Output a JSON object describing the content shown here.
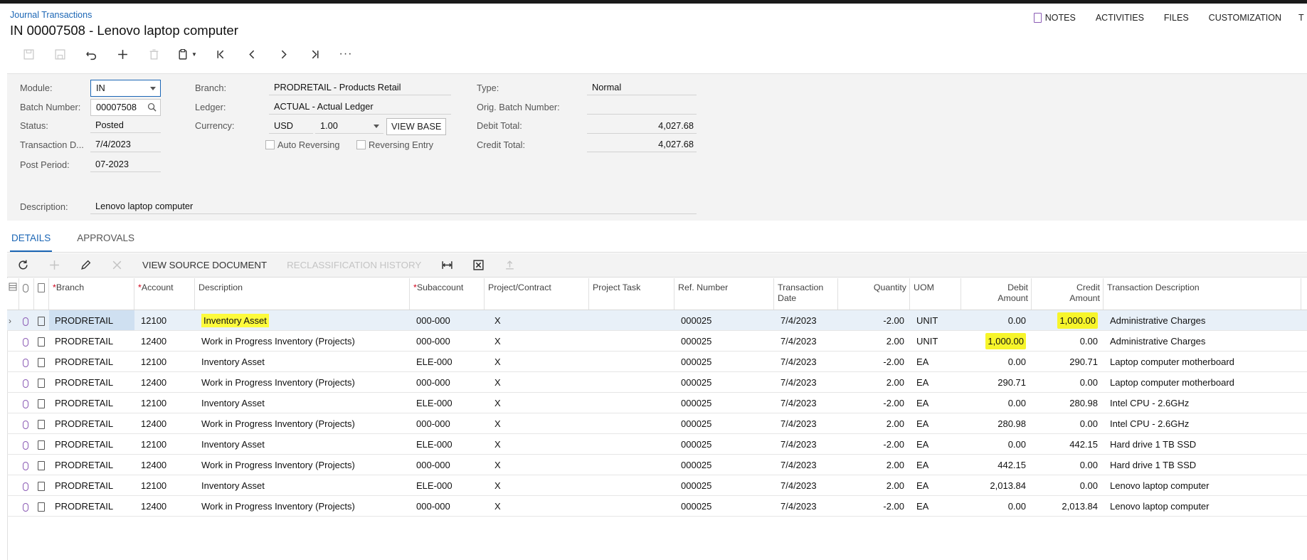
{
  "breadcrumb": "Journal Transactions",
  "title": "IN 00007508 - Lenovo laptop computer",
  "top_links": [
    "NOTES",
    "ACTIVITIES",
    "FILES",
    "CUSTOMIZATION",
    "T"
  ],
  "toolbar_icons": [
    "save-close-icon",
    "save-icon",
    "undo-icon",
    "add-icon",
    "delete-icon",
    "copy-paste-icon",
    "first-icon",
    "prev-icon",
    "next-icon",
    "last-icon",
    "more-icon"
  ],
  "form": {
    "module_label": "Module:",
    "module_value": "IN",
    "batch_label": "Batch Number:",
    "batch_value": "00007508",
    "status_label": "Status:",
    "status_value": "Posted",
    "trans_date_label": "Transaction D...",
    "trans_date_value": "7/4/2023",
    "post_period_label": "Post Period:",
    "post_period_value": "07-2023",
    "branch_label": "Branch:",
    "branch_value": "PRODRETAIL - Products Retail",
    "ledger_label": "Ledger:",
    "ledger_value": "ACTUAL - Actual Ledger",
    "currency_label": "Currency:",
    "currency_value": "USD",
    "rate_value": "1.00",
    "view_base": "VIEW BASE",
    "auto_reversing": "Auto Reversing",
    "reversing_entry": "Reversing Entry",
    "type_label": "Type:",
    "type_value": "Normal",
    "orig_batch_label": "Orig. Batch Number:",
    "orig_batch_value": "",
    "debit_total_label": "Debit Total:",
    "debit_total_value": "4,027.68",
    "credit_total_label": "Credit Total:",
    "credit_total_value": "4,027.68",
    "description_label": "Description:",
    "description_value": "Lenovo laptop computer"
  },
  "tabs": [
    "DETAILS",
    "APPROVALS"
  ],
  "grid_toolbar": {
    "view_source": "VIEW SOURCE DOCUMENT",
    "reclass_history": "RECLASSIFICATION HISTORY"
  },
  "columns": {
    "branch": "Branch",
    "account": "Account",
    "description": "Description",
    "subaccount": "Subaccount",
    "project": "Project/Contract",
    "task": "Project Task",
    "ref": "Ref. Number",
    "tdate1": "Transaction",
    "tdate2": "Date",
    "qty": "Quantity",
    "uom": "UOM",
    "debit1": "Debit",
    "debit2": "Amount",
    "credit1": "Credit",
    "credit2": "Amount",
    "tdesc": "Transaction Description"
  },
  "rows": [
    {
      "branch": "PRODRETAIL",
      "account": "12100",
      "description": "Inventory Asset",
      "sub": "000-000",
      "project": "X",
      "task": "",
      "ref": "000025",
      "date": "7/4/2023",
      "qty": "-2.00",
      "uom": "UNIT",
      "debit": "0.00",
      "credit": "1,000.00",
      "tdesc": "Administrative Charges"
    },
    {
      "branch": "PRODRETAIL",
      "account": "12400",
      "description": "Work in Progress Inventory (Projects)",
      "sub": "000-000",
      "project": "X",
      "task": "",
      "ref": "000025",
      "date": "7/4/2023",
      "qty": "2.00",
      "uom": "UNIT",
      "debit": "1,000.00",
      "credit": "0.00",
      "tdesc": "Administrative Charges"
    },
    {
      "branch": "PRODRETAIL",
      "account": "12100",
      "description": "Inventory Asset",
      "sub": "ELE-000",
      "project": "X",
      "task": "",
      "ref": "000025",
      "date": "7/4/2023",
      "qty": "-2.00",
      "uom": "EA",
      "debit": "0.00",
      "credit": "290.71",
      "tdesc": "Laptop computer motherboard"
    },
    {
      "branch": "PRODRETAIL",
      "account": "12400",
      "description": "Work in Progress Inventory (Projects)",
      "sub": "000-000",
      "project": "X",
      "task": "",
      "ref": "000025",
      "date": "7/4/2023",
      "qty": "2.00",
      "uom": "EA",
      "debit": "290.71",
      "credit": "0.00",
      "tdesc": "Laptop computer motherboard"
    },
    {
      "branch": "PRODRETAIL",
      "account": "12100",
      "description": "Inventory Asset",
      "sub": "ELE-000",
      "project": "X",
      "task": "",
      "ref": "000025",
      "date": "7/4/2023",
      "qty": "-2.00",
      "uom": "EA",
      "debit": "0.00",
      "credit": "280.98",
      "tdesc": "Intel CPU - 2.6GHz"
    },
    {
      "branch": "PRODRETAIL",
      "account": "12400",
      "description": "Work in Progress Inventory (Projects)",
      "sub": "000-000",
      "project": "X",
      "task": "",
      "ref": "000025",
      "date": "7/4/2023",
      "qty": "2.00",
      "uom": "EA",
      "debit": "280.98",
      "credit": "0.00",
      "tdesc": "Intel CPU - 2.6GHz"
    },
    {
      "branch": "PRODRETAIL",
      "account": "12100",
      "description": "Inventory Asset",
      "sub": "ELE-000",
      "project": "X",
      "task": "",
      "ref": "000025",
      "date": "7/4/2023",
      "qty": "-2.00",
      "uom": "EA",
      "debit": "0.00",
      "credit": "442.15",
      "tdesc": "Hard drive 1 TB SSD"
    },
    {
      "branch": "PRODRETAIL",
      "account": "12400",
      "description": "Work in Progress Inventory (Projects)",
      "sub": "000-000",
      "project": "X",
      "task": "",
      "ref": "000025",
      "date": "7/4/2023",
      "qty": "2.00",
      "uom": "EA",
      "debit": "442.15",
      "credit": "0.00",
      "tdesc": "Hard drive 1 TB SSD"
    },
    {
      "branch": "PRODRETAIL",
      "account": "12100",
      "description": "Inventory Asset",
      "sub": "ELE-000",
      "project": "X",
      "task": "",
      "ref": "000025",
      "date": "7/4/2023",
      "qty": "2.00",
      "uom": "EA",
      "debit": "2,013.84",
      "credit": "0.00",
      "tdesc": "Lenovo laptop computer"
    },
    {
      "branch": "PRODRETAIL",
      "account": "12400",
      "description": "Work in Progress Inventory (Projects)",
      "sub": "000-000",
      "project": "X",
      "task": "",
      "ref": "000025",
      "date": "7/4/2023",
      "qty": "-2.00",
      "uom": "EA",
      "debit": "0.00",
      "credit": "2,013.84",
      "tdesc": "Lenovo laptop computer"
    }
  ],
  "highlight_color": "#fdfb3c",
  "accent_color": "#1b66b5"
}
